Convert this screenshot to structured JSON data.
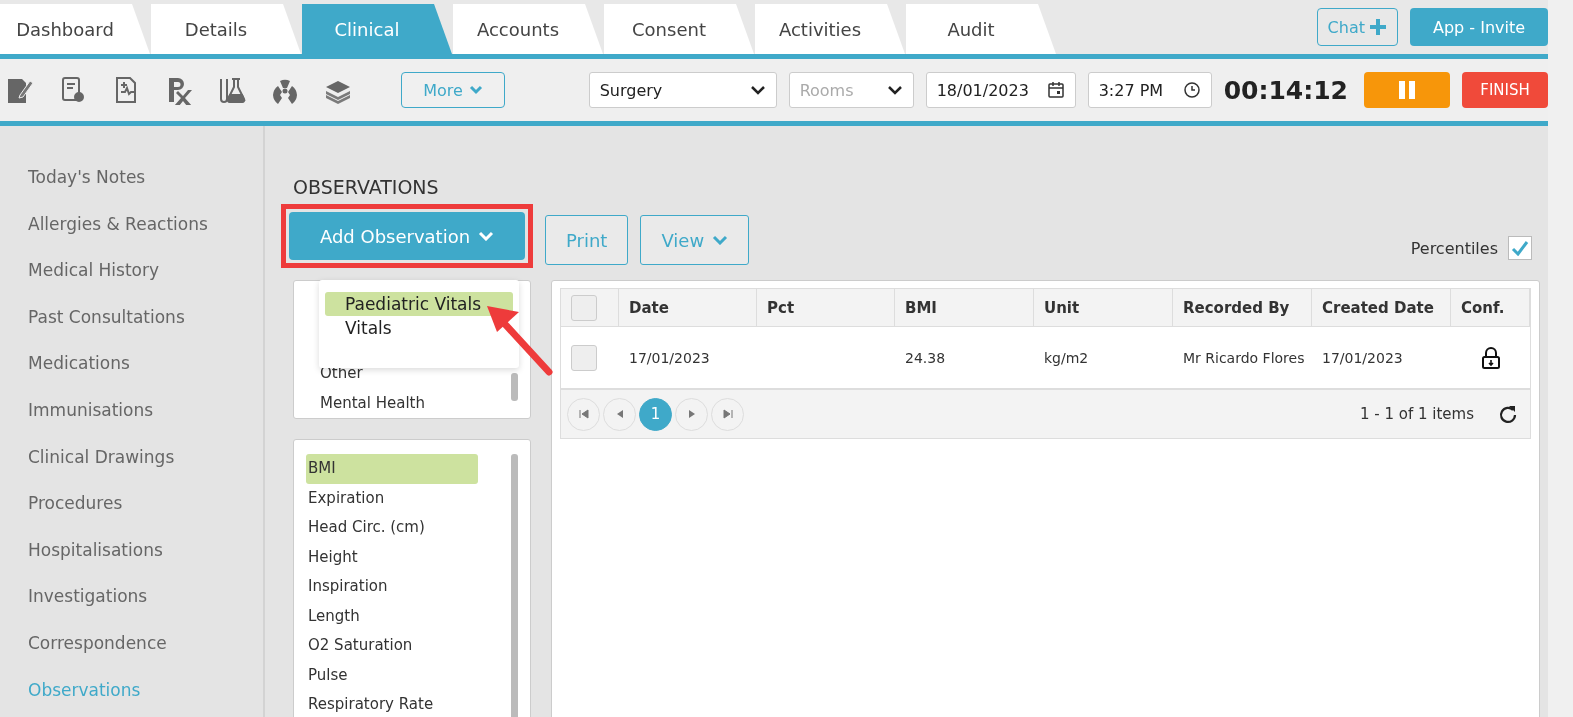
{
  "tabs": [
    {
      "label": "Dashboard",
      "selected": false
    },
    {
      "label": "Details",
      "selected": false
    },
    {
      "label": "Clinical",
      "selected": true
    },
    {
      "label": "Accounts",
      "selected": false
    },
    {
      "label": "Consent",
      "selected": false
    },
    {
      "label": "Activities",
      "selected": false
    },
    {
      "label": "Audit",
      "selected": false
    }
  ],
  "header_buttons": {
    "chat": "Chat",
    "app_invite": "App - Invite"
  },
  "toolbar": {
    "more": "More",
    "location": "Surgery",
    "rooms_placeholder": "Rooms",
    "date": "18/01/2023",
    "time": "3:27 PM",
    "timer": "00:14:12",
    "finish": "FINISH"
  },
  "sidebar": {
    "items": [
      {
        "label": "Today's Notes",
        "selected": false
      },
      {
        "label": "Allergies & Reactions",
        "selected": false
      },
      {
        "label": "Medical History",
        "selected": false
      },
      {
        "label": "Past Consultations",
        "selected": false
      },
      {
        "label": "Medications",
        "selected": false
      },
      {
        "label": "Immunisations",
        "selected": false
      },
      {
        "label": "Clinical Drawings",
        "selected": false
      },
      {
        "label": "Procedures",
        "selected": false
      },
      {
        "label": "Hospitalisations",
        "selected": false
      },
      {
        "label": "Investigations",
        "selected": false
      },
      {
        "label": "Correspondence",
        "selected": false
      },
      {
        "label": "Observations",
        "selected": true
      }
    ]
  },
  "title": "OBSERVATIONS",
  "actions": {
    "add": "Add Observation",
    "print": "Print",
    "view": "View"
  },
  "percentiles": {
    "label": "Percentiles",
    "checked": true
  },
  "dropdown": {
    "items": [
      {
        "label": "Paediatric Vitals",
        "selected": true
      },
      {
        "label": "Vitals",
        "selected": false
      }
    ]
  },
  "group_list": {
    "items": [
      {
        "label": "Other",
        "selected": false
      },
      {
        "label": "Mental Health",
        "selected": false
      }
    ]
  },
  "type_list": {
    "items": [
      {
        "label": "BMI",
        "selected": true
      },
      {
        "label": "Expiration",
        "selected": false
      },
      {
        "label": "Head Circ. (cm)",
        "selected": false
      },
      {
        "label": "Height",
        "selected": false
      },
      {
        "label": "Inspiration",
        "selected": false
      },
      {
        "label": "Length",
        "selected": false
      },
      {
        "label": "O2 Saturation",
        "selected": false
      },
      {
        "label": "Pulse",
        "selected": false
      },
      {
        "label": "Respiratory Rate",
        "selected": false
      }
    ]
  },
  "table": {
    "all_checked": false,
    "columns": [
      "Date",
      "Pct",
      "BMI",
      "Unit",
      "Recorded By",
      "Created Date",
      "Conf."
    ],
    "rows": [
      {
        "checked": false,
        "cells": [
          "17/01/2023",
          "",
          "24.38",
          "kg/m2",
          "Mr Ricardo Flores",
          "17/01/2023"
        ]
      }
    ]
  },
  "pager": {
    "page": "1",
    "summary": "1 - 1 of 1 items"
  }
}
